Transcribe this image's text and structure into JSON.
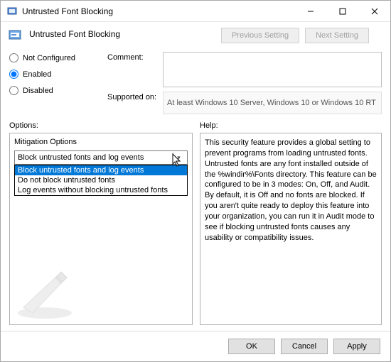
{
  "window": {
    "title": "Untrusted Font Blocking",
    "subtitle": "Untrusted Font Blocking"
  },
  "nav": {
    "prev": "Previous Setting",
    "next": "Next Setting"
  },
  "radios": {
    "not_configured": "Not Configured",
    "enabled": "Enabled",
    "disabled": "Disabled",
    "selected": "enabled"
  },
  "labels": {
    "comment": "Comment:",
    "supported": "Supported on:",
    "options": "Options:",
    "help": "Help:"
  },
  "comment_value": "",
  "supported_text": "At least Windows 10 Server, Windows 10 or Windows 10 RT",
  "mitigation": {
    "label": "Mitigation Options",
    "selected": "Block untrusted fonts and log events",
    "options": [
      "Block untrusted fonts and log events",
      "Do not block untrusted fonts",
      "Log events without blocking untrusted fonts"
    ]
  },
  "help_text": "This security feature provides a global setting to prevent programs from loading untrusted fonts. Untrusted fonts are any font installed outside of the %windir%\\Fonts directory. This feature can be configured to be in 3 modes: On, Off, and Audit. By default, it is Off and no fonts are blocked. If you aren't quite ready to deploy this feature into your organization, you can run it in Audit mode to see if blocking untrusted fonts causes any usability or compatibility issues.",
  "footer": {
    "ok": "OK",
    "cancel": "Cancel",
    "apply": "Apply"
  }
}
